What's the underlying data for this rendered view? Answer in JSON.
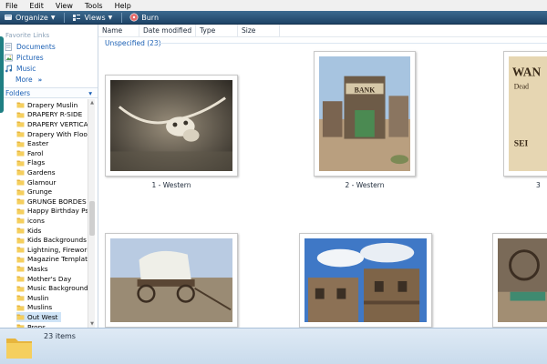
{
  "menu": [
    "File",
    "Edit",
    "View",
    "Tools",
    "Help"
  ],
  "toolbar": {
    "organize": "Organize",
    "views": "Views",
    "burn": "Burn"
  },
  "nav": {
    "favorites_title": "Favorite Links",
    "favorites": [
      "Documents",
      "Pictures",
      "Music"
    ],
    "more": "More",
    "more_glyph": "»",
    "folders_title": "Folders",
    "folders_glyph": "▾",
    "folders": [
      "Drapery Muslin",
      "DRAPERY R-SIDE",
      "DRAPERY VERTICAL",
      "Drapery With Floor",
      "Easter",
      "Farol",
      "Flags",
      "Gardens",
      "Glamour",
      "Grunge",
      "GRUNGE BORDES",
      "Happy Birthday Psd",
      "icons",
      "Kids",
      "Kids Backgrounds",
      "Lightning, Fireworks,",
      "Magazine Templates",
      "Masks",
      "Mother's Day",
      "Music Backgrounds",
      "Muslin",
      "Muslins",
      "Out West",
      "Props"
    ],
    "selected_folder": "Out West"
  },
  "columns": [
    "Name",
    "Date modified",
    "Type",
    "Size"
  ],
  "group_label": "Unspecified (23)",
  "thumbnails": [
    {
      "caption": "1 - Western",
      "subject": "cow-skull"
    },
    {
      "caption": "2 - Western",
      "subject": "old-bank-building"
    },
    {
      "caption": "3",
      "subject": "wanted-poster"
    },
    {
      "caption": "",
      "subject": "covered-wagon"
    },
    {
      "caption": "",
      "subject": "western-town-facade"
    },
    {
      "caption": "",
      "subject": "wagon-wheel-scene"
    }
  ],
  "thumb_text": {
    "bank_sign": "BANK",
    "wanted": "WAN",
    "dead": "Dead",
    "sem": "SEI"
  },
  "status": {
    "items": "23 items"
  },
  "colors": {
    "toolbar": "#2a5478",
    "link": "#1a5fb4",
    "folder": "#f2c94c",
    "selection": "#cfe4f7"
  }
}
